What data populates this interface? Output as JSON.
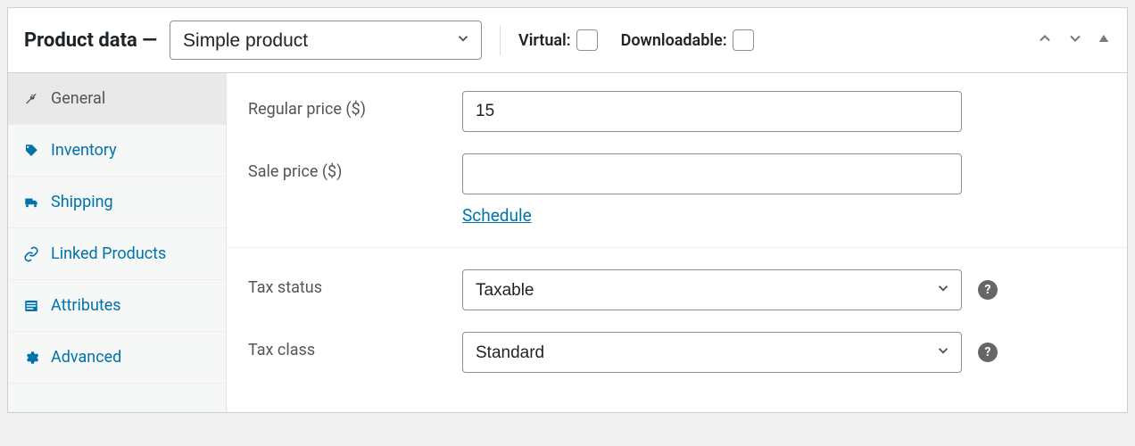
{
  "header": {
    "title": "Product data —",
    "product_type": "Simple product",
    "virtual_label": "Virtual:",
    "downloadable_label": "Downloadable:"
  },
  "sidebar": {
    "items": [
      {
        "label": "General"
      },
      {
        "label": "Inventory"
      },
      {
        "label": "Shipping"
      },
      {
        "label": "Linked Products"
      },
      {
        "label": "Attributes"
      },
      {
        "label": "Advanced"
      }
    ]
  },
  "fields": {
    "regular_price_label": "Regular price ($)",
    "regular_price_value": "15",
    "sale_price_label": "Sale price ($)",
    "sale_price_value": "",
    "schedule_link": "Schedule",
    "tax_status_label": "Tax status",
    "tax_status_value": "Taxable",
    "tax_class_label": "Tax class",
    "tax_class_value": "Standard"
  }
}
